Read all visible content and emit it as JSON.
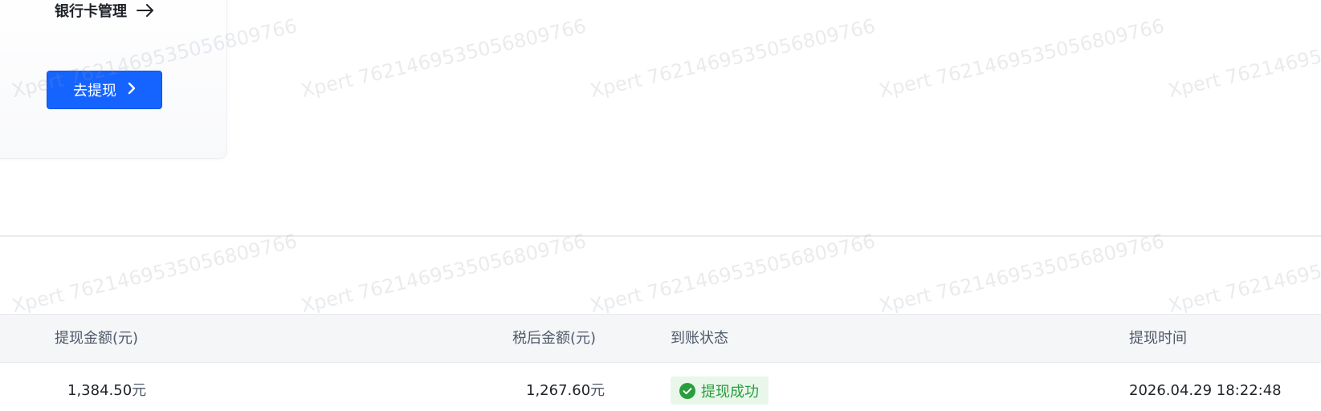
{
  "card": {
    "bank_link_label": "银行卡管理",
    "withdraw_button_label": "去提现"
  },
  "table": {
    "headers": {
      "amount": "提现金额(元)",
      "after_tax": "税后金额(元)",
      "status": "到账状态",
      "time": "提现时间"
    },
    "rows": [
      {
        "amount": "1,384.50",
        "amount_unit": "元",
        "after_tax": "1,267.60",
        "after_tax_unit": "元",
        "status": "提现成功",
        "time": "2026.04.29 18:22:48"
      }
    ]
  },
  "watermark": "Xpert 7621469535056809766",
  "colors": {
    "primary": "#1664ff",
    "success": "#2a9d3c",
    "success_bg": "#e8f7ea"
  },
  "icons": {
    "bank_link": "arrow-right-icon",
    "withdraw_button": "chevron-right-icon",
    "status": "check-circle-icon"
  }
}
